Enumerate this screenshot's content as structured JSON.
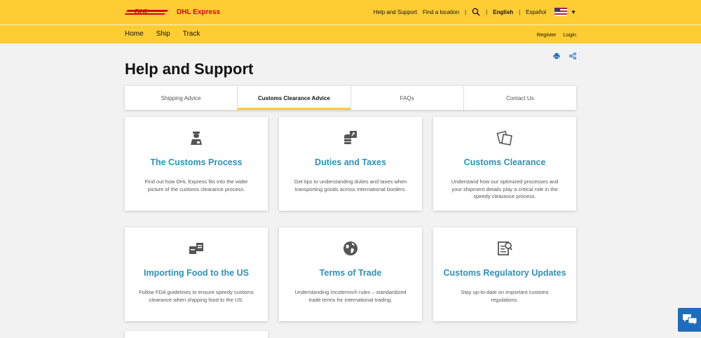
{
  "header": {
    "brand": "DHL Express",
    "links": {
      "help": "Help and Support",
      "locate": "Find a location"
    },
    "lang": {
      "english": "English",
      "spanish": "Español"
    },
    "sep": "|"
  },
  "nav": {
    "items": [
      "Home",
      "Ship",
      "Track"
    ],
    "register": "Register",
    "login": "Login"
  },
  "page": {
    "title": "Help and Support"
  },
  "tabs": [
    {
      "label": "Shipping Advice",
      "active": false
    },
    {
      "label": "Customs Clearance Advice",
      "active": true
    },
    {
      "label": "FAQs",
      "active": false
    },
    {
      "label": "Contact Us",
      "active": false
    }
  ],
  "cards": [
    {
      "icon": "customs-officer-icon",
      "title": "The Customs Process",
      "desc": "Find out how DHL Express fits into the wider picture of the customs clearance process."
    },
    {
      "icon": "coins-icon",
      "title": "Duties and Taxes",
      "desc": "Get tips to understanding duties and taxes when transporting goods across international borders."
    },
    {
      "icon": "documents-icon",
      "title": "Customs Clearance",
      "desc": "Understand how our optimized processes and your shipment details play a critical role in the speedy clearance process."
    },
    {
      "icon": "food-boxes-icon",
      "title": "Importing Food to the US",
      "desc": "Follow FDA guidelines to ensure speedy customs clearance when shipping food to the US."
    },
    {
      "icon": "globe-icon",
      "title": "Terms of Trade",
      "desc": "Understanding Incoterms® rules – standardized trade terms for international trading."
    },
    {
      "icon": "document-search-icon",
      "title": "Customs Regulatory Updates",
      "desc": "Stay up-to-date on important customs regulations."
    }
  ],
  "colors": {
    "brand_yellow": "#fecc33",
    "brand_red": "#d40511",
    "link_blue": "#2d91b8",
    "chat_blue": "#1e6dbd"
  }
}
